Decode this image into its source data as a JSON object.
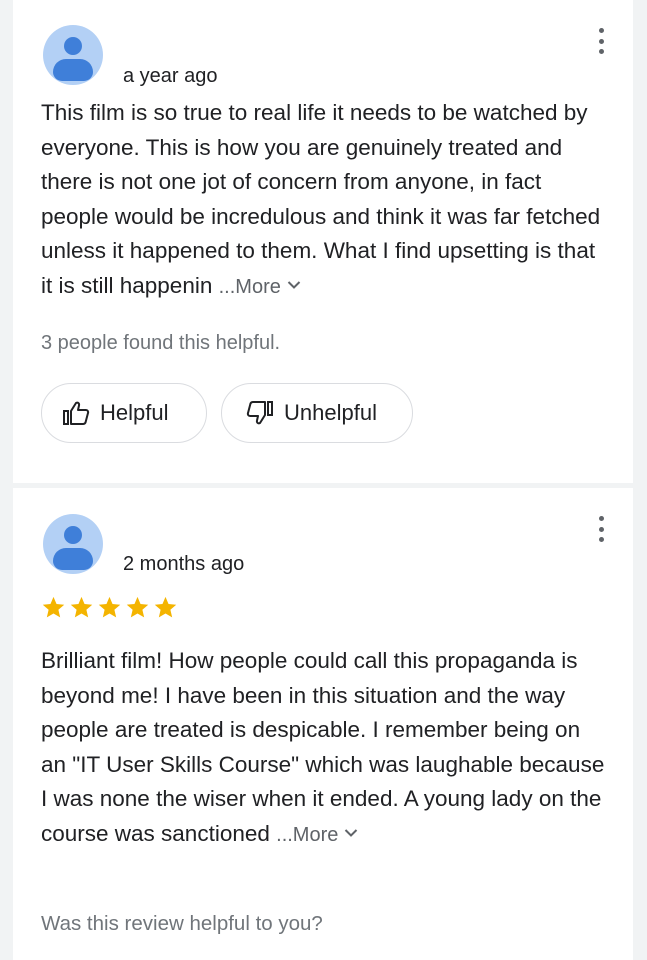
{
  "colors": {
    "star": "#f4b400",
    "avatar_bg": "#b3d0f5",
    "avatar_fg": "#3f7fd9",
    "muted_text": "#70757a"
  },
  "reviews": [
    {
      "avatar_icon": "person-icon",
      "time": "a year ago",
      "text": "This film is so true to real life it needs to be watched by everyone. This is how you are genuinely treated and there is not one jot of concern from anyone, in fact people would be incredulous and think it was far fetched unless it happened to them. What I find upsetting is that it is still happenin ",
      "more_label": "...More",
      "helpful_count_text": "3 people found this helpful.",
      "helpful_label": "Helpful",
      "unhelpful_label": "Unhelpful"
    },
    {
      "avatar_icon": "person-icon",
      "time": "2 months ago",
      "rating": 5,
      "rating_max": 5,
      "text": "Brilliant film!  How people could call this propaganda is beyond me! I have been in this situation and the way people are treated is despicable.  I remember being on an \"IT User Skills Course\" which was laughable because I was none the wiser when it ended.  A young lady on the course was sanctioned  ",
      "more_label": "...More",
      "helpful_question": "Was this review helpful to you?"
    }
  ]
}
